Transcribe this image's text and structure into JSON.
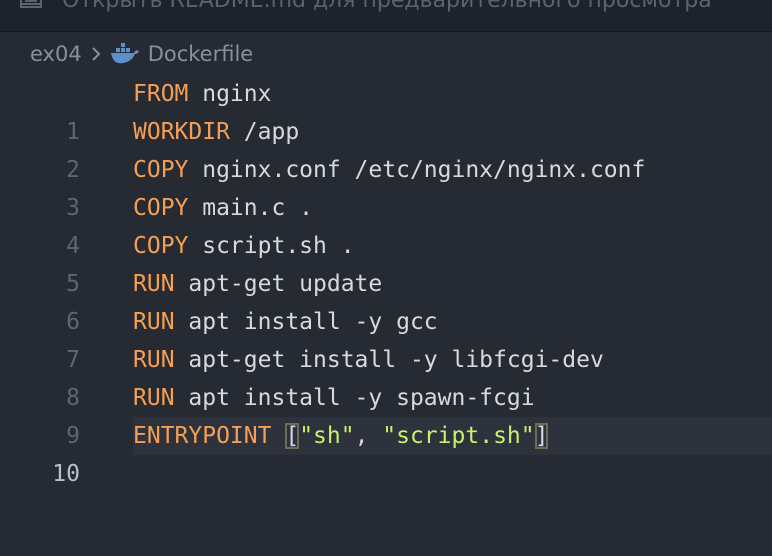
{
  "topbar": {
    "text": "Открыть README.md для предварительного просмотра",
    "icon": "preview-icon"
  },
  "breadcrumb": {
    "folder": "ex04",
    "separator_icon": "chevron-right-icon",
    "file_icon": "docker-icon",
    "file": "Dockerfile"
  },
  "editor": {
    "active_line": 10,
    "lines": [
      {
        "num": "1",
        "kw": "FROM",
        "rest": " nginx"
      },
      {
        "num": "2",
        "kw": "WORKDIR",
        "rest": " /app"
      },
      {
        "num": "3",
        "kw": "COPY",
        "rest": " nginx.conf /etc/nginx/nginx.conf"
      },
      {
        "num": "4",
        "kw": "COPY",
        "rest": " main.c ."
      },
      {
        "num": "5",
        "kw": "COPY",
        "rest": " script.sh ."
      },
      {
        "num": "6",
        "kw": "RUN",
        "rest": " apt-get update"
      },
      {
        "num": "7",
        "kw": "RUN",
        "rest": " apt install -y gcc"
      },
      {
        "num": "8",
        "kw": "RUN",
        "rest": " apt-get install -y libfcgi-dev"
      },
      {
        "num": "9",
        "kw": "RUN",
        "rest": " apt install -y spawn-fcgi"
      },
      {
        "num": "10",
        "kw": "ENTRYPOINT",
        "space": " ",
        "open": "[",
        "s1": "\"sh\"",
        "comma": ", ",
        "s2": "\"script.sh\"",
        "close": "]"
      }
    ]
  },
  "colors": {
    "keyword": "#f59f55",
    "string": "#c6f26c",
    "text": "#d6dae0",
    "background": "#252a33"
  }
}
